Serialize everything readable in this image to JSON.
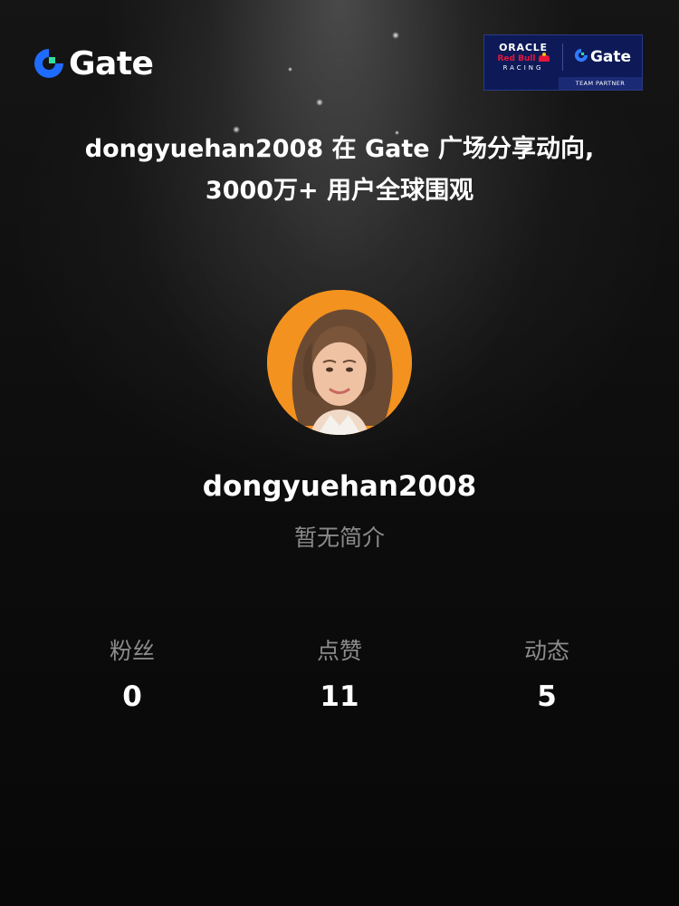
{
  "brand": {
    "logo_text": "Gate",
    "accent_color": "#1f6bff",
    "avatar_bg_color": "#f4921f"
  },
  "partner_badge": {
    "oracle": "ORACLE",
    "redbull": "Red Bull",
    "racing": "RACING",
    "gate": "Gate",
    "footer": "TEAM PARTNER"
  },
  "headline": {
    "line1": "dongyuehan2008 在 Gate 广场分享动向,",
    "line2": "3000万+ 用户全球围观"
  },
  "profile": {
    "username": "dongyuehan2008",
    "bio": "暂无简介"
  },
  "stats": [
    {
      "label": "粉丝",
      "value": "0"
    },
    {
      "label": "点赞",
      "value": "11"
    },
    {
      "label": "动态",
      "value": "5"
    }
  ]
}
